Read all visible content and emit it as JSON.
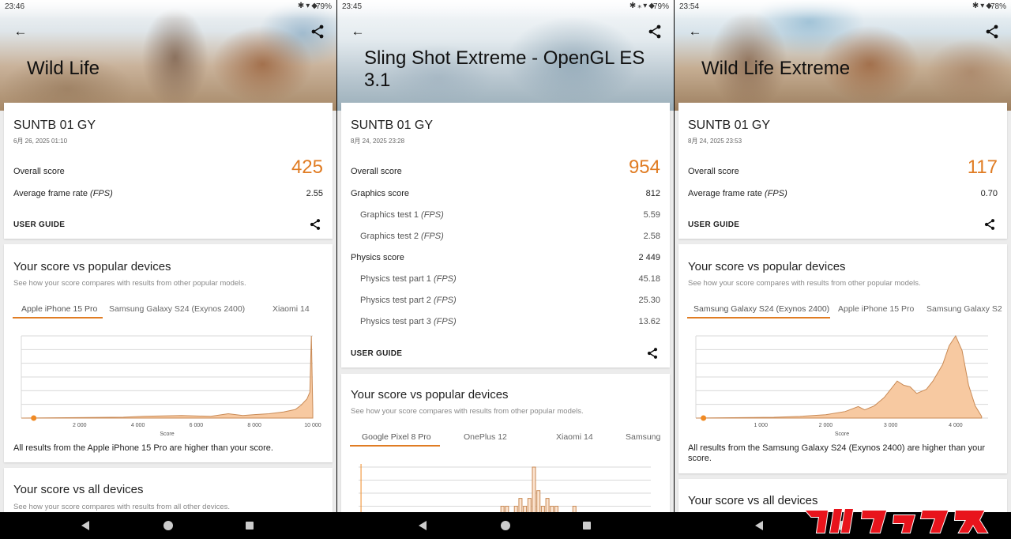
{
  "panels": [
    {
      "status": {
        "time": "23:46",
        "battery": "79%"
      },
      "title": "Wild Life",
      "device": {
        "name": "SUNTB 01 GY",
        "date": "6月 26, 2025 01:10"
      },
      "overall": {
        "label": "Overall score",
        "value": "425"
      },
      "rows": [
        {
          "label": "Average frame rate",
          "unit": "(FPS)",
          "value": "2.55",
          "sub": false
        }
      ],
      "user_guide": "USER GUIDE",
      "popular": {
        "title": "Your score vs popular devices",
        "subtitle": "See how your score compares with results from other popular models.",
        "tabs": [
          "Apple iPhone 15 Pro",
          "Samsung Galaxy S24 (Exynos 2400)",
          "Xiaomi 14"
        ],
        "active_tab": 0,
        "note": "All results from the Apple iPhone 15 Pro are higher than your score."
      },
      "all_devices": {
        "title": "Your score vs all devices",
        "subtitle": "See how your score compares with results from all other devices."
      }
    },
    {
      "status": {
        "time": "23:45",
        "battery": "79%"
      },
      "title": "Sling Shot Extreme - OpenGL ES 3.1",
      "device": {
        "name": "SUNTB 01 GY",
        "date": "8月 24, 2025 23:28"
      },
      "overall": {
        "label": "Overall score",
        "value": "954"
      },
      "rows": [
        {
          "label": "Graphics score",
          "unit": "",
          "value": "812",
          "sub": false
        },
        {
          "label": "Graphics test 1",
          "unit": "(FPS)",
          "value": "5.59",
          "sub": true
        },
        {
          "label": "Graphics test 2",
          "unit": "(FPS)",
          "value": "2.58",
          "sub": true
        },
        {
          "label": "Physics score",
          "unit": "",
          "value": "2 449",
          "sub": false
        },
        {
          "label": "Physics test part 1",
          "unit": "(FPS)",
          "value": "45.18",
          "sub": true
        },
        {
          "label": "Physics test part 2",
          "unit": "(FPS)",
          "value": "25.30",
          "sub": true
        },
        {
          "label": "Physics test part 3",
          "unit": "(FPS)",
          "value": "13.62",
          "sub": true
        }
      ],
      "user_guide": "USER GUIDE",
      "popular": {
        "title": "Your score vs popular devices",
        "subtitle": "See how your score compares with results from other popular models.",
        "tabs": [
          "Google Pixel 8 Pro",
          "OnePlus 12",
          "Xiaomi 14",
          "Samsung"
        ],
        "active_tab": 0
      }
    },
    {
      "status": {
        "time": "23:54",
        "battery": "78%"
      },
      "title": "Wild Life Extreme",
      "device": {
        "name": "SUNTB 01 GY",
        "date": "8月 24, 2025 23:53"
      },
      "overall": {
        "label": "Overall score",
        "value": "117"
      },
      "rows": [
        {
          "label": "Average frame rate",
          "unit": "(FPS)",
          "value": "0.70",
          "sub": false
        }
      ],
      "user_guide": "USER GUIDE",
      "popular": {
        "title": "Your score vs popular devices",
        "subtitle": "See how your score compares with results from other popular models.",
        "tabs": [
          "Samsung Galaxy S24 (Exynos 2400)",
          "Apple iPhone 15 Pro",
          "Samsung Galaxy S2"
        ],
        "active_tab": 0,
        "note": "All results from the Samsung Galaxy S24 (Exynos 2400) are higher than your score."
      },
      "all_devices": {
        "title": "Your score vs all devices"
      }
    }
  ],
  "chart_data": [
    {
      "type": "area",
      "xlabel": "Score",
      "xlim": [
        0,
        10000
      ],
      "xticks": [
        "2 000",
        "4 000",
        "6 000",
        "8 000",
        "10 000"
      ],
      "xtick_values": [
        2000,
        4000,
        6000,
        8000,
        10000
      ],
      "your_score": 425,
      "x": [
        0,
        3500,
        4200,
        5500,
        6500,
        7100,
        7600,
        8000,
        8500,
        9000,
        9400,
        9600,
        9800,
        9900,
        9950,
        10000
      ],
      "values": [
        0,
        1,
        2,
        3,
        2,
        5,
        3,
        4,
        5,
        7,
        10,
        15,
        22,
        30,
        95,
        10
      ]
    },
    {
      "type": "bar",
      "your_score": 954,
      "x": [
        4100,
        4200,
        4300,
        4400,
        4500,
        4600,
        4700,
        4800,
        4900,
        5000,
        5100,
        5200,
        5300,
        5400,
        5700,
        6000
      ],
      "values": [
        25,
        25,
        0,
        25,
        40,
        25,
        40,
        100,
        55,
        25,
        40,
        25,
        25,
        0,
        25,
        0
      ]
    },
    {
      "type": "area",
      "xlabel": "Score",
      "xlim": [
        0,
        4500
      ],
      "xticks": [
        "1 000",
        "2 000",
        "3 000",
        "4 000"
      ],
      "xtick_values": [
        1000,
        2000,
        3000,
        4000
      ],
      "your_score": 117,
      "x": [
        0,
        1200,
        1600,
        2000,
        2300,
        2500,
        2600,
        2750,
        2900,
        3100,
        3200,
        3300,
        3400,
        3550,
        3650,
        3800,
        3900,
        4000,
        4100,
        4200,
        4300,
        4400
      ],
      "values": [
        0,
        1,
        2,
        4,
        8,
        14,
        10,
        15,
        25,
        45,
        40,
        38,
        30,
        35,
        45,
        65,
        88,
        100,
        82,
        40,
        15,
        2
      ]
    }
  ]
}
